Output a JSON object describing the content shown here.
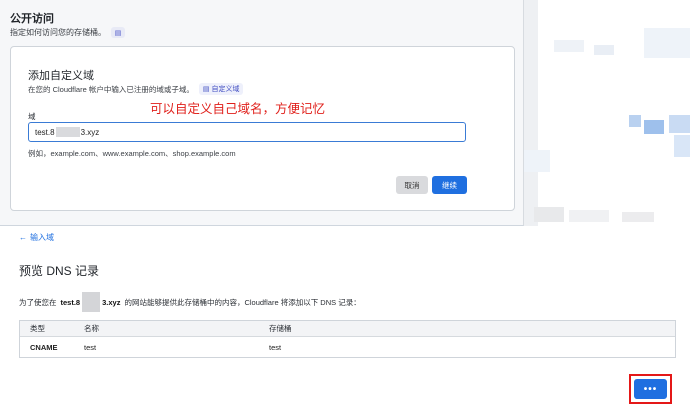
{
  "public_access": {
    "title": "公开访问",
    "subtitle": "指定如何访问您的存储桶。",
    "doc_icon": "document-icon"
  },
  "custom_domain": {
    "title": "添加自定义域",
    "subtitle": "在您的 Cloudflare 帐户中输入已注册的域或子域。",
    "badge_label": "自定义域",
    "field_label": "域",
    "input_value_prefix": "test.8",
    "input_value_suffix": "3.xyz",
    "examples": "例如，example.com、www.example.com、shop.example.com",
    "cancel_label": "取消",
    "continue_label": "继续"
  },
  "annotation": "可以自定义自己域名，方便记忆",
  "dns_preview": {
    "back_link": "输入域",
    "title": "预览 DNS 记录",
    "desc_prefix": "为了使您在",
    "domain_prefix": "test.8",
    "domain_suffix": "3.xyz",
    "desc_suffix": "的网站能够提供此存储桶中的内容，Cloudflare 将添加以下 DNS 记录：",
    "columns": [
      "类型",
      "名称",
      "存储桶"
    ],
    "rows": [
      {
        "type": "CNAME",
        "name": "test",
        "bucket": "test"
      }
    ],
    "more_label": "•••"
  },
  "colors": {
    "accent": "#1f6fe0",
    "annotation_red": "#e0201b",
    "highlight_red": "#e41818"
  }
}
